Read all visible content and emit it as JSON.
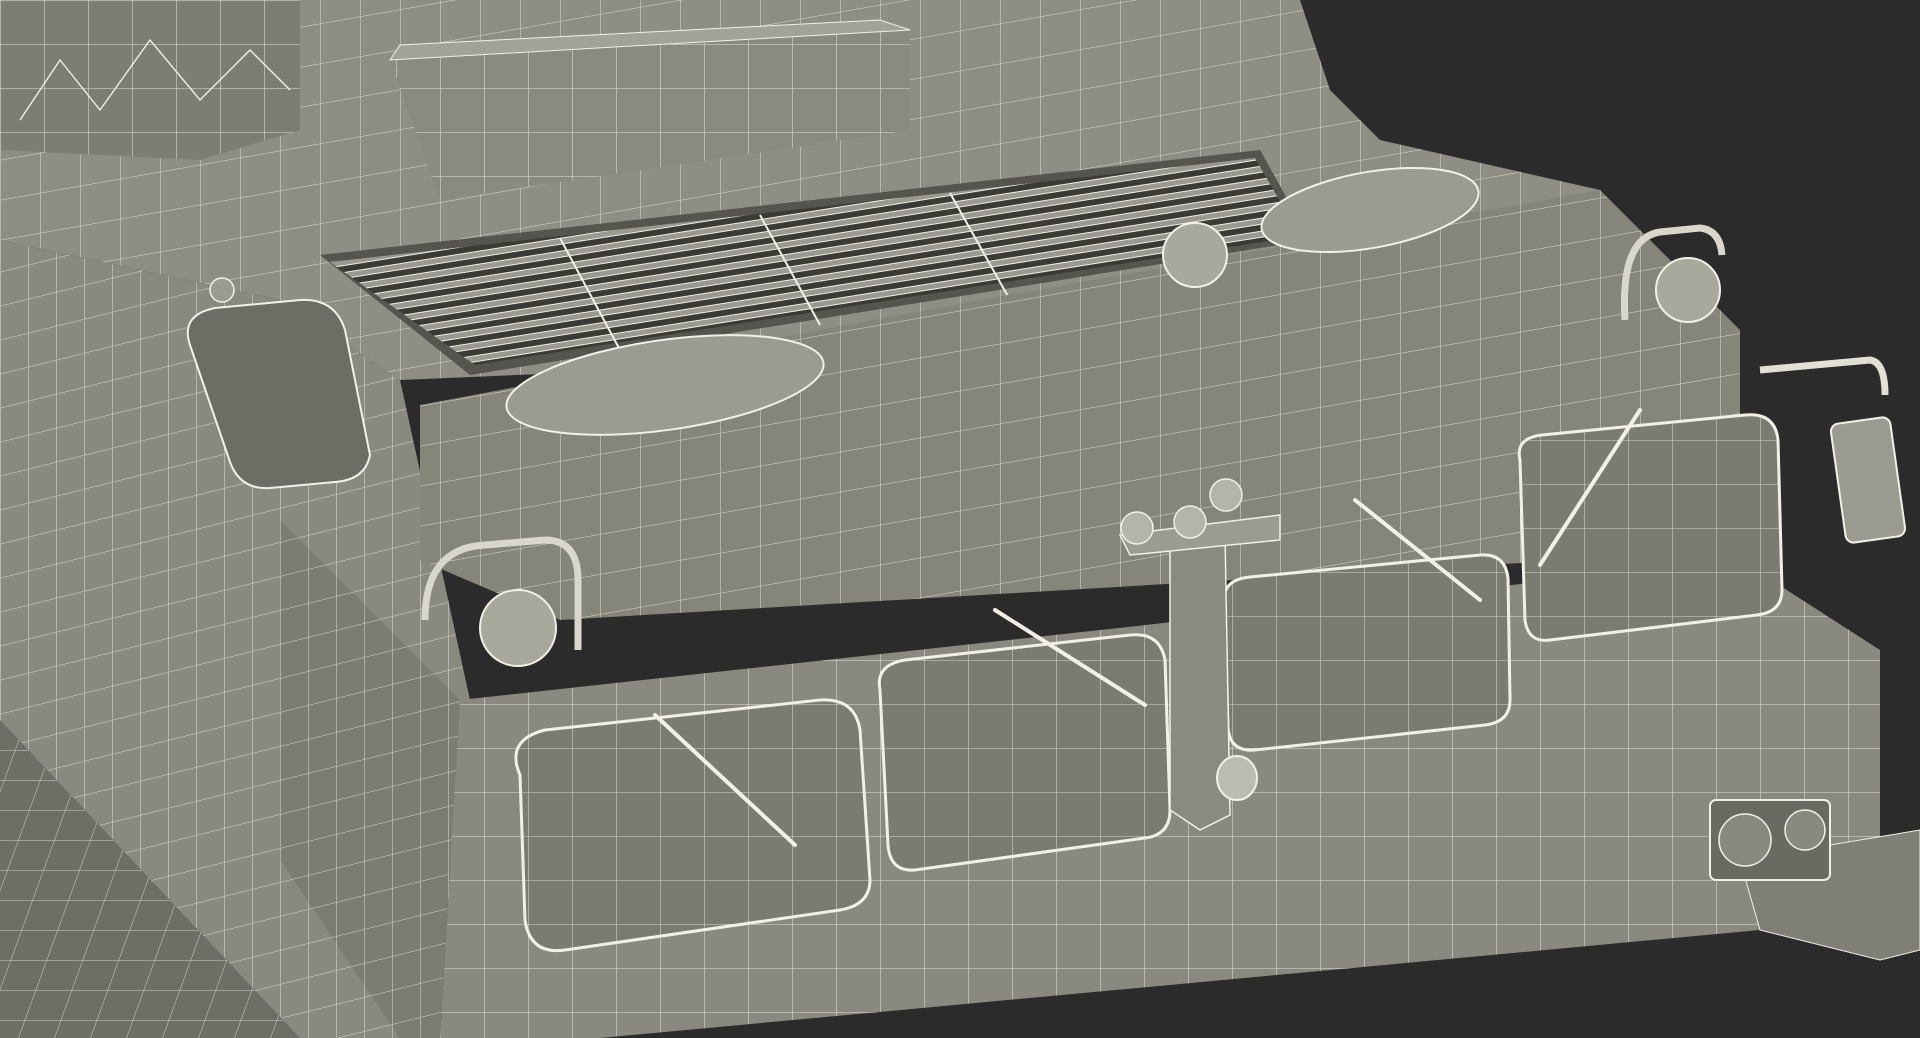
{
  "scene": {
    "subject": "wireframe-render-tracked-vehicle-front",
    "colors": {
      "background": "#2b2b2b",
      "surface": "#8a897f",
      "surface_light": "#a3a298",
      "surface_dark": "#6b6a62",
      "wire": "#f2f0e6",
      "shadow": "#55544e"
    }
  }
}
